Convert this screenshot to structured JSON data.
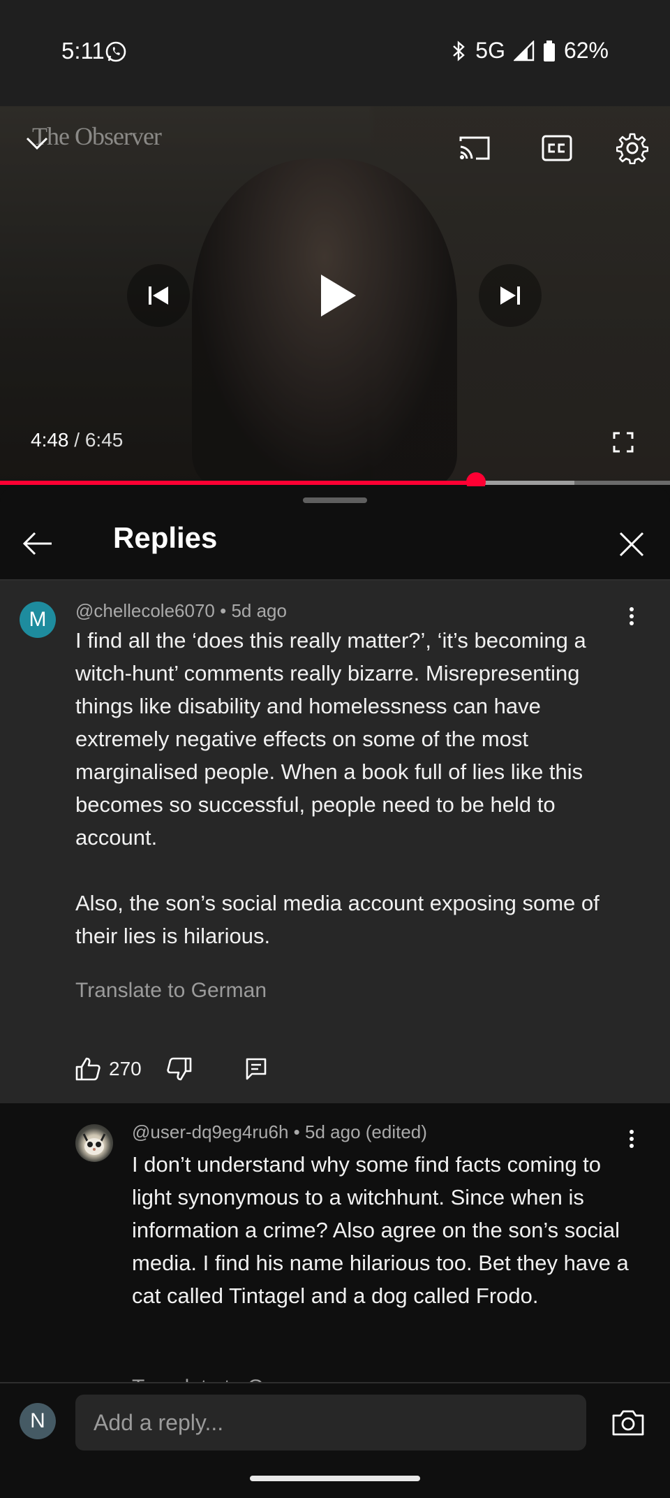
{
  "status_bar": {
    "time": "5:11",
    "network": "5G",
    "battery": "62%"
  },
  "video": {
    "logo_text": "The Observer",
    "current_time": "4:48",
    "separator": " / ",
    "duration": "6:45",
    "progress_fraction": 0.71,
    "buffered_fraction": 0.857,
    "accent_color": "#ff0033",
    "icons": [
      "chevron-down-icon",
      "cast-icon",
      "closed-captions-icon",
      "settings-gear-icon",
      "previous-icon",
      "play-icon",
      "next-icon",
      "fullscreen-icon"
    ]
  },
  "replies_panel": {
    "title": "Replies",
    "icons": [
      "back-arrow-icon",
      "close-icon"
    ]
  },
  "parent_comment": {
    "avatar_letter": "M",
    "avatar_color": "#1e8c9e",
    "author": "@chellecole6070",
    "meta_sep": " • ",
    "age": "5d ago",
    "text": "I find all the ‘does this really matter?’, ‘it’s becoming a witch-hunt’ comments really bizarre. Misrepresenting things like disability and homelessness can have extremely negative effects on some of the most marginalised people. When a book full of lies like this becomes so successful, people need to be held to account.\n\nAlso, the son’s social media account exposing some of their lies is hilarious.",
    "translate_label": "Translate to German",
    "likes": "270",
    "icons": [
      "thumbs-up-icon",
      "thumbs-down-icon",
      "reply-comment-icon",
      "more-vertical-icon"
    ]
  },
  "reply": {
    "author": "@user-dq9eg4ru6h",
    "meta_sep": " • ",
    "age": "5d ago (edited)",
    "text": "I don’t understand why some find facts coming to light synonymous to a witchhunt. Since when is information a crime? Also agree on the son’s social media. I find his name hilarious too. Bet they have a cat called Tintagel and a dog called Frodo.",
    "translate_label": "Translate to German"
  },
  "composer": {
    "avatar_letter": "N",
    "placeholder": "Add a reply...",
    "icons": [
      "camera-icon"
    ]
  }
}
